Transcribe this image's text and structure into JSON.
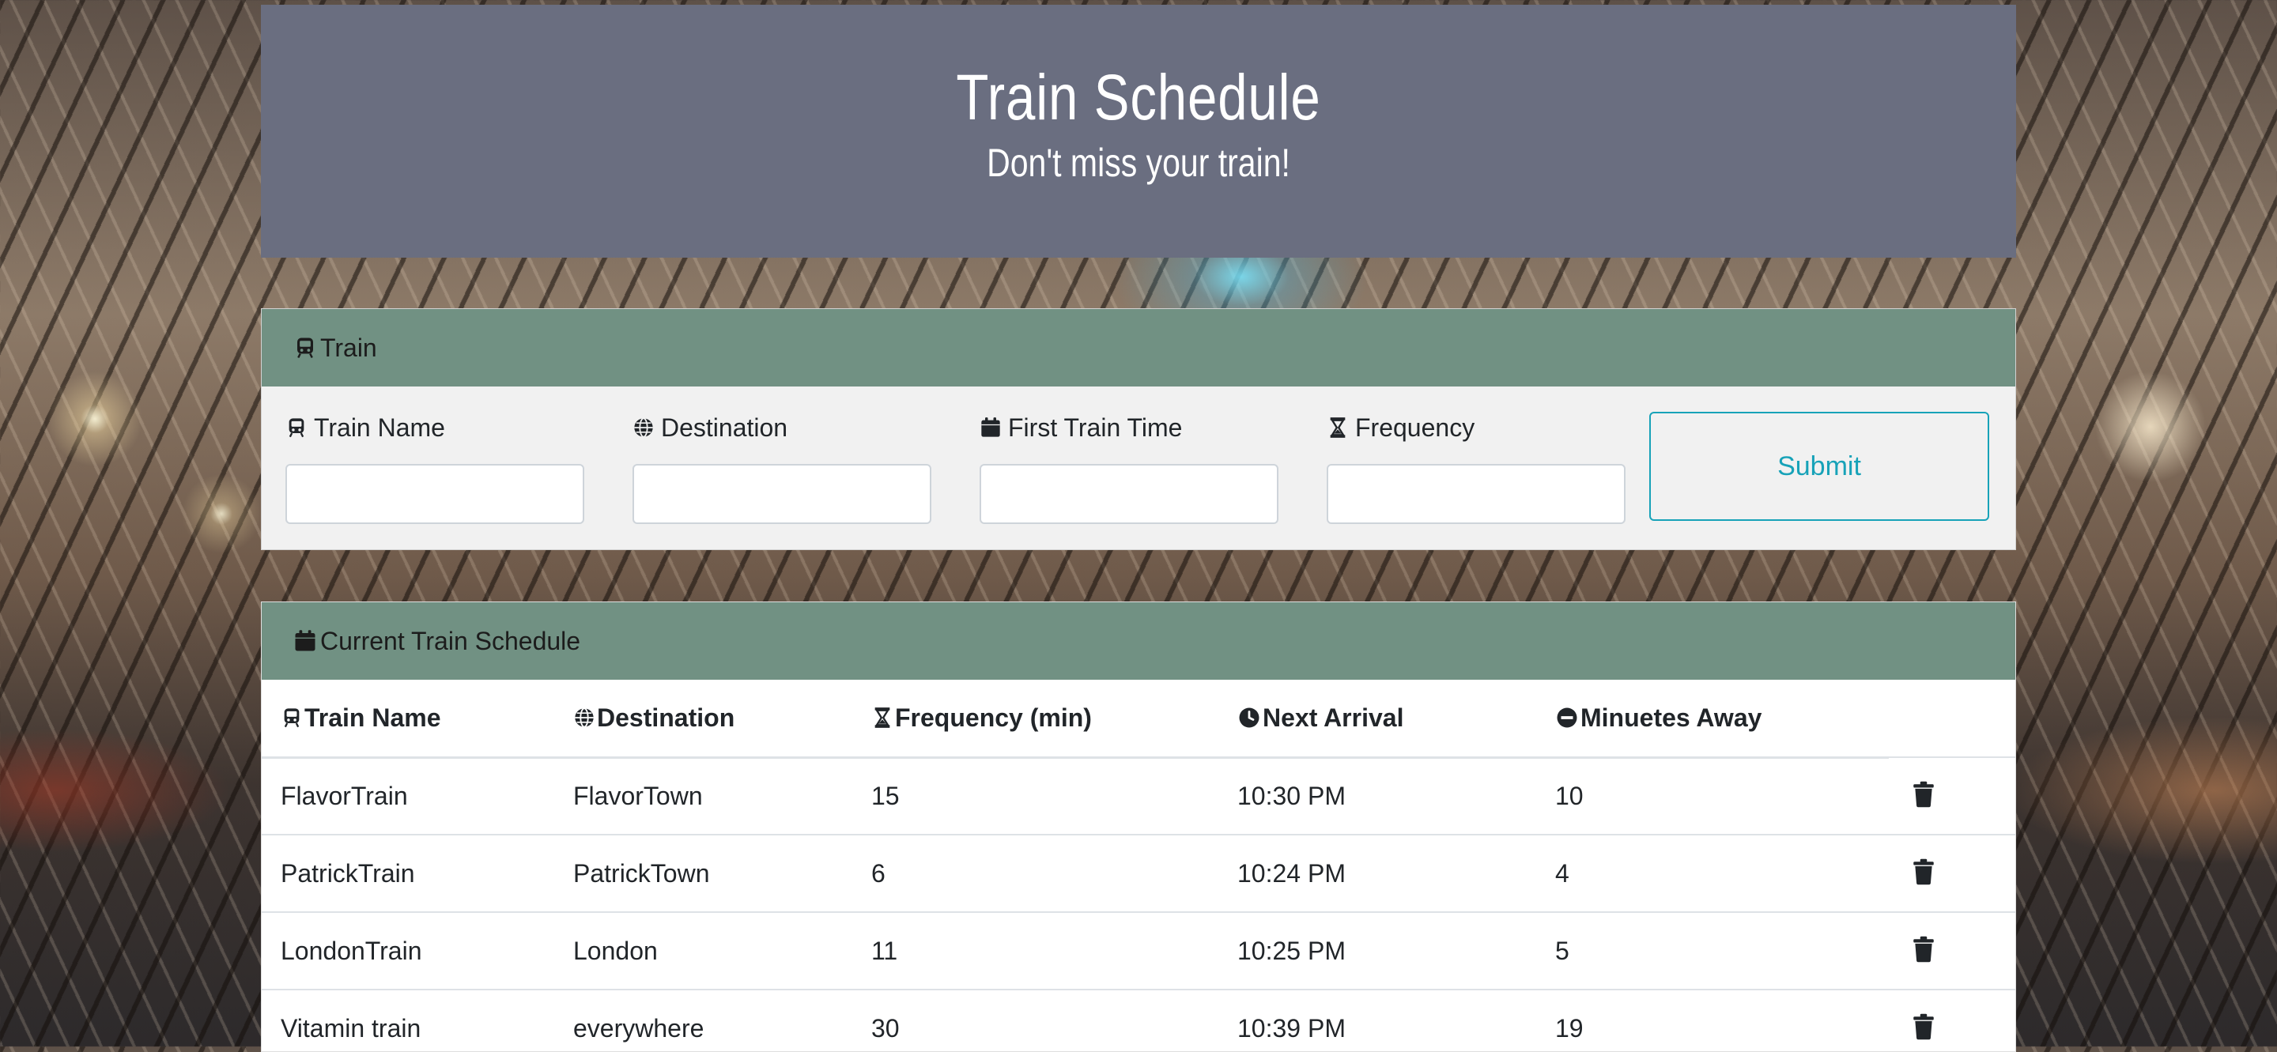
{
  "header": {
    "title": "Train Schedule",
    "subtitle": "Don't miss your train!"
  },
  "form": {
    "card_title": "Train",
    "fields": [
      {
        "label": "Train Name",
        "icon": "train-icon",
        "value": "",
        "placeholder": ""
      },
      {
        "label": "Destination",
        "icon": "globe-icon",
        "value": "",
        "placeholder": ""
      },
      {
        "label": "First Train Time",
        "icon": "calendar-icon",
        "value": "",
        "placeholder": ""
      },
      {
        "label": "Frequency",
        "icon": "hourglass-icon",
        "value": "",
        "placeholder": ""
      }
    ],
    "submit_label": "Submit"
  },
  "schedule": {
    "card_title": "Current Train Schedule",
    "columns": [
      {
        "label": "Train Name",
        "icon": "train-icon"
      },
      {
        "label": "Destination",
        "icon": "globe-icon"
      },
      {
        "label": "Frequency (min)",
        "icon": "hourglass-icon"
      },
      {
        "label": " Next Arrival",
        "icon": "clock-icon"
      },
      {
        "label": " Minuetes Away",
        "icon": "minus-circle-icon"
      }
    ],
    "rows": [
      {
        "name": "FlavorTrain",
        "destination": "FlavorTown",
        "frequency": "15",
        "next_arrival": "10:30 PM",
        "minutes_away": "10"
      },
      {
        "name": "PatrickTrain",
        "destination": "PatrickTown",
        "frequency": "6",
        "next_arrival": "10:24 PM",
        "minutes_away": "4"
      },
      {
        "name": "LondonTrain",
        "destination": "London",
        "frequency": "11",
        "next_arrival": "10:25 PM",
        "minutes_away": "5"
      },
      {
        "name": "Vitamin train",
        "destination": "everywhere",
        "frequency": "30",
        "next_arrival": "10:39 PM",
        "minutes_away": "19"
      }
    ],
    "row_action_icon": "trash-icon"
  }
}
